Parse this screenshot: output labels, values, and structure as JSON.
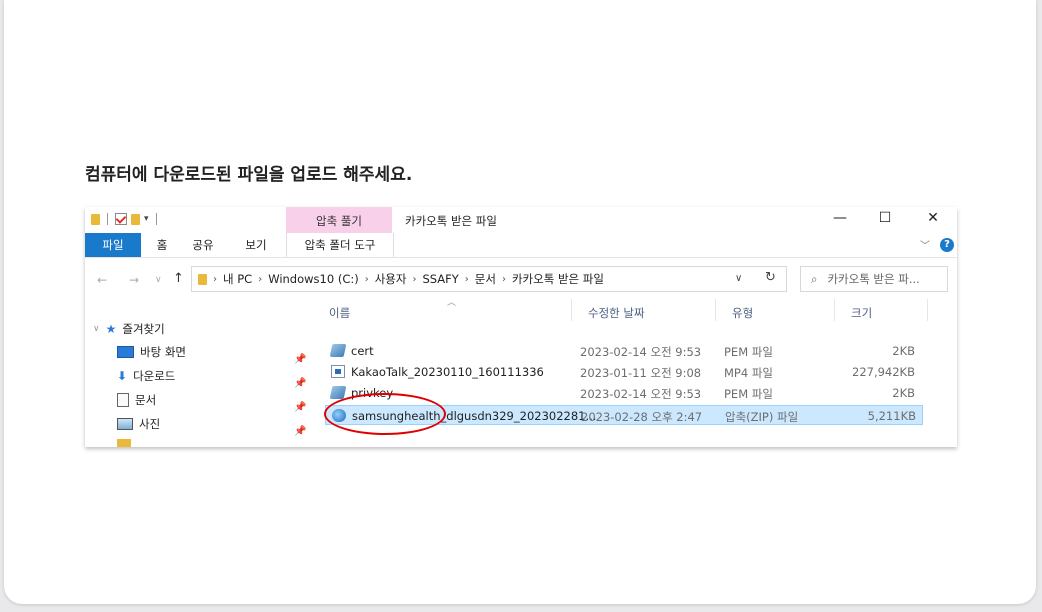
{
  "heading": "컴퓨터에 다운로드된 파일을 업로드 해주세요.",
  "explorer": {
    "context_tab": "압축 풀기",
    "window_title": "카카오톡 받은 파일",
    "window_controls": {
      "minimize": "—",
      "maximize": "☐",
      "close": "✕"
    },
    "ribbon_tabs": {
      "file": "파일",
      "home": "홈",
      "share": "공유",
      "view": "보기",
      "tools": "압축 폴더 도구"
    },
    "help": "?",
    "breadcrumb": [
      "내 PC",
      "Windows10 (C:)",
      "사용자",
      "SSAFY",
      "문서",
      "카카오톡 받은 파일"
    ],
    "search_placeholder": "카카오톡 받은 파...",
    "nav_pane": {
      "quick_access": "즐겨찾기",
      "items": [
        "바탕 화면",
        "다운로드",
        "문서",
        "사진",
        ""
      ]
    },
    "columns": {
      "name": "이름",
      "date": "수정한 날짜",
      "type": "유형",
      "size": "크기"
    },
    "files": [
      {
        "name": "cert",
        "date": "2023-02-14 오전 9:53",
        "type": "PEM 파일",
        "size": "2KB",
        "icon": "certificate-icon"
      },
      {
        "name": "KakaoTalk_20230110_160111336",
        "date": "2023-01-11 오전 9:08",
        "type": "MP4 파일",
        "size": "227,942KB",
        "icon": "video-file-icon"
      },
      {
        "name": "privkey",
        "date": "2023-02-14 오전 9:53",
        "type": "PEM 파일",
        "size": "2KB",
        "icon": "certificate-icon"
      },
      {
        "name": "samsunghealth_dlgusdn329_202302281...",
        "date": "2023-02-28 오후 2:47",
        "type": "압축(ZIP) 파일",
        "size": "5,211KB",
        "icon": "zip-file-icon",
        "selected": true
      }
    ]
  },
  "colors": {
    "accent": "#1979ca",
    "selection": "#cce8ff",
    "highlight_ellipse": "#e00000",
    "context_tab": "#f9d0ea"
  }
}
